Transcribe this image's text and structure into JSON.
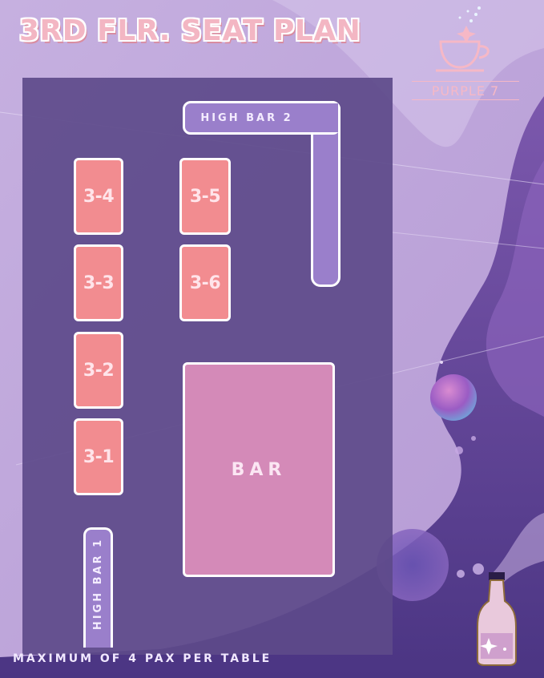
{
  "title": "3RD FLR. SEAT PLAN",
  "brand": "PURPLE 7",
  "footer": "MAXIMUM OF 4 PAX PER TABLE",
  "areas": {
    "high_bar_2": "HIGH BAR 2",
    "high_bar_1": "HIGH BAR 1",
    "bar": "BAR"
  },
  "tables": [
    "3-4",
    "3-3",
    "3-2",
    "3-1",
    "3-5",
    "3-6"
  ],
  "colors": {
    "table": "#f28c90",
    "bar": "#d48ab8",
    "high_bar": "#9a7fcb",
    "floor": "#5d4a8a",
    "title": "#f3b6c3"
  },
  "icons": [
    "cup-logo-icon",
    "soda-bottle-icon",
    "planet-icon"
  ]
}
